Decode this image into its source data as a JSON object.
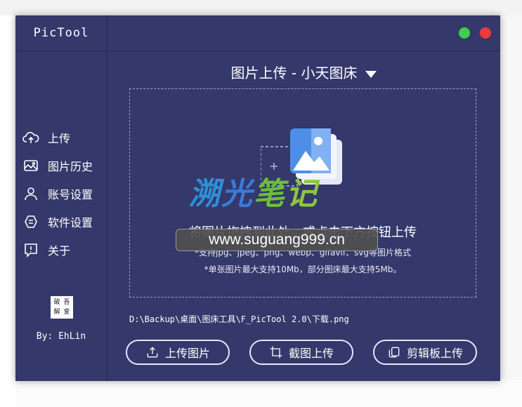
{
  "app": {
    "title": "PicTool",
    "author": "By: EhLin"
  },
  "logo": {
    "chars": [
      "破",
      "吾",
      "解",
      "爱"
    ]
  },
  "sidebar": {
    "items": [
      {
        "label": "上传",
        "icon": "cloud-upload-icon"
      },
      {
        "label": "图片历史",
        "icon": "image-history-icon"
      },
      {
        "label": "账号设置",
        "icon": "user-icon"
      },
      {
        "label": "软件设置",
        "icon": "settings-icon"
      },
      {
        "label": "关于",
        "icon": "info-icon"
      }
    ]
  },
  "header": {
    "mode": "图片上传 - 小天图床"
  },
  "dropzone": {
    "text": "将图片拖拽到此处，或点击下方按钮上传",
    "hint1": "*支持jpg、jpeg、png、webp、gifavif、svg等图片格式",
    "hint2": "*单张图片最大支持10Mb，部分图床最大支持5Mb。"
  },
  "watermark": {
    "cn": [
      "溯",
      "光",
      "笔",
      "记"
    ],
    "url": "www.suguang999.cn"
  },
  "file_path": "D:\\Backup\\桌面\\图床工具\\F_PicTool 2.0\\下载.png",
  "buttons": {
    "upload": "上传图片",
    "screenshot": "截图上传",
    "clipboard": "剪辑板上传"
  },
  "colors": {
    "bg": "#34386b",
    "green": "#3fcf4b",
    "red": "#f03a3a"
  }
}
